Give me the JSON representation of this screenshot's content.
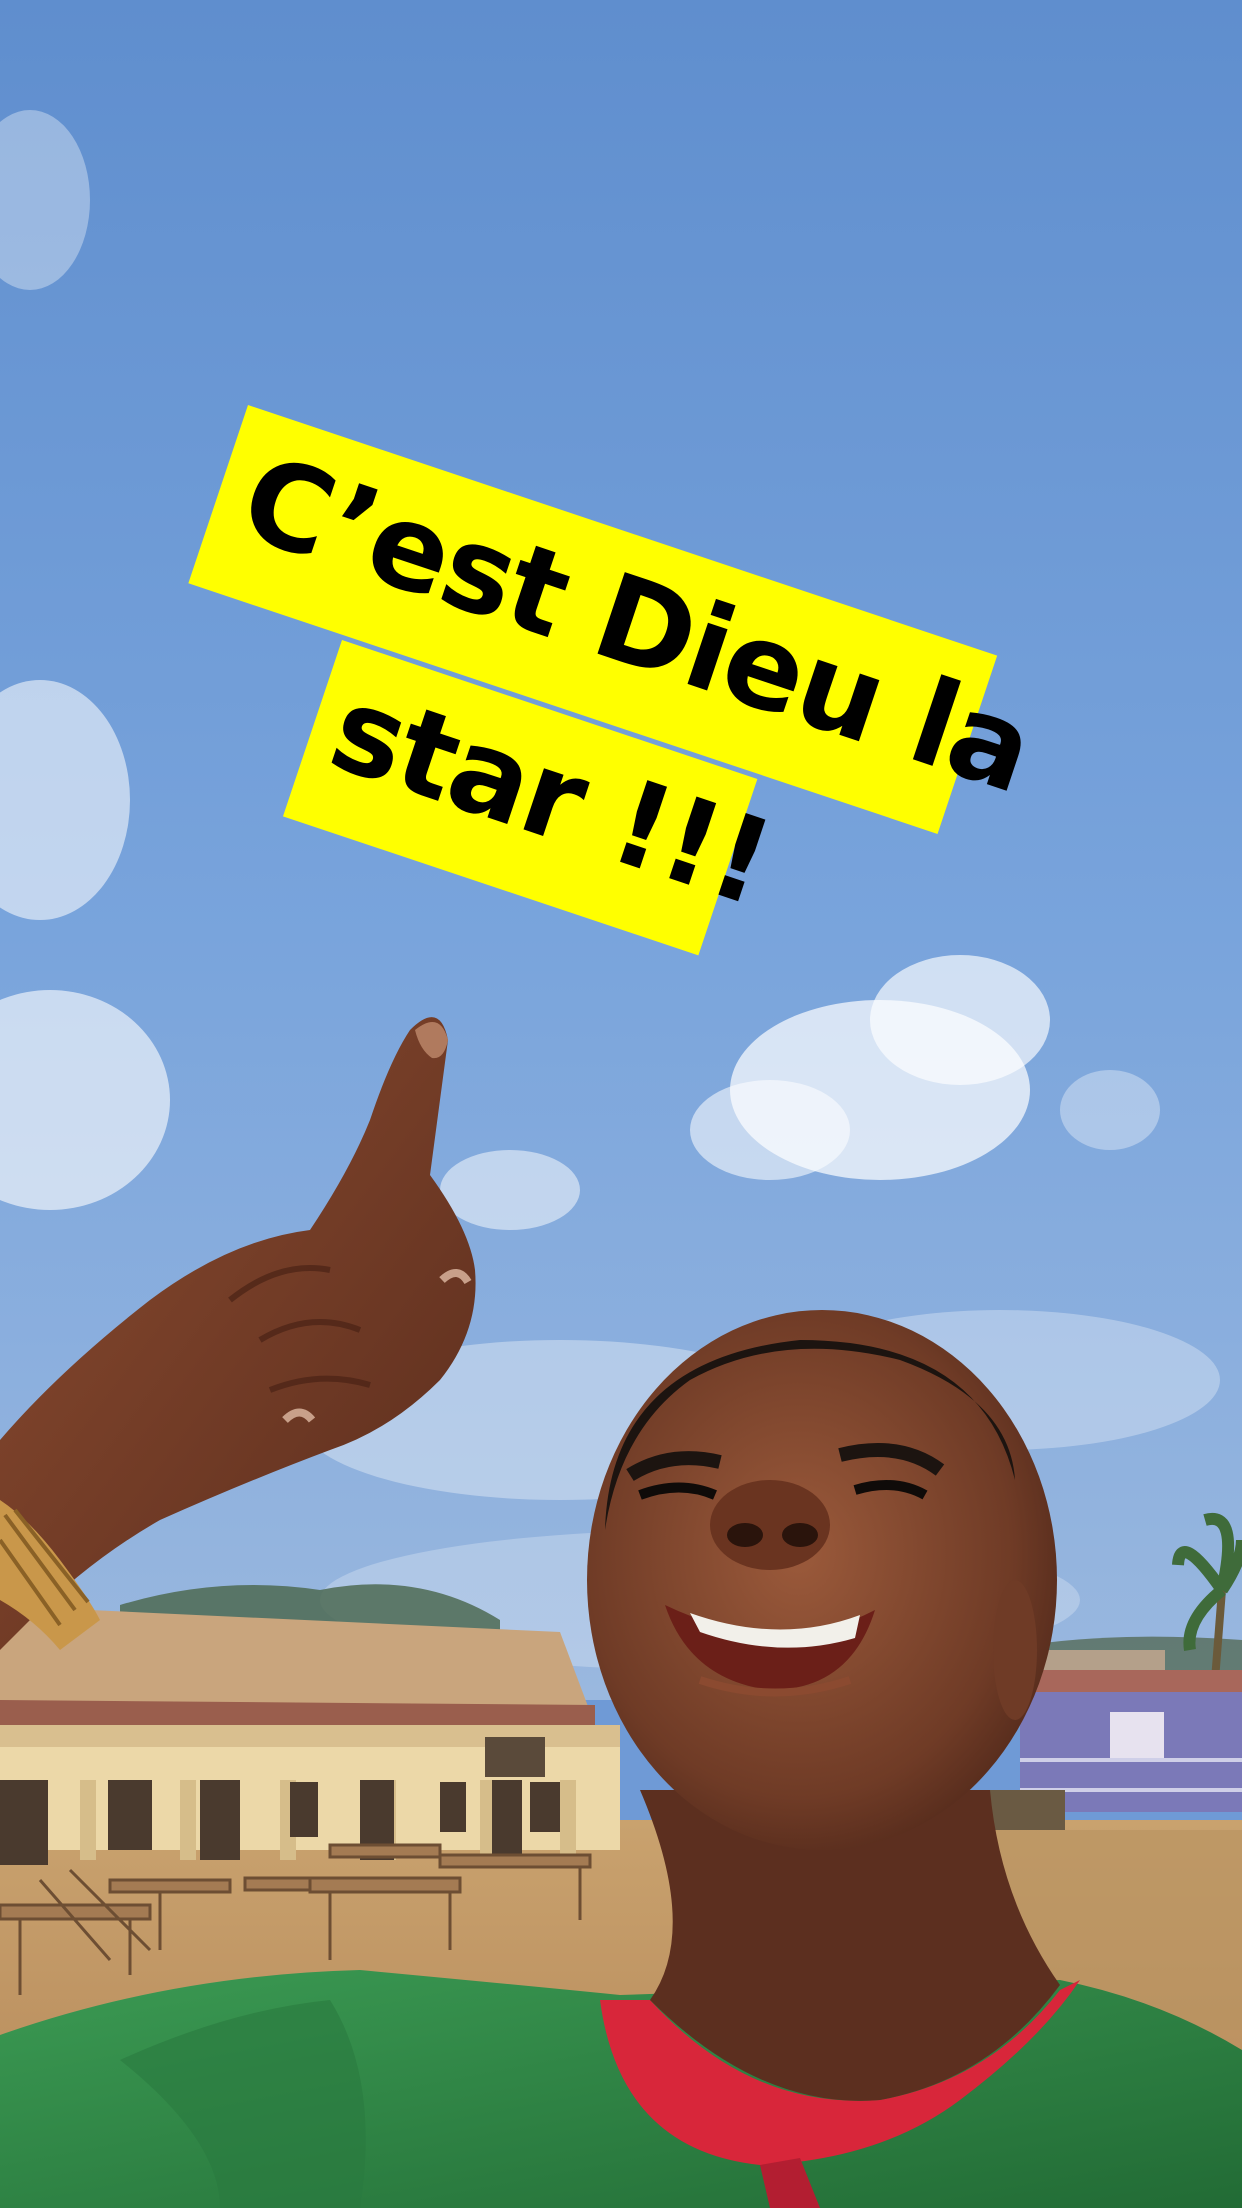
{
  "caption": {
    "line1": "C’est Dieu la",
    "line2": "star !!!"
  },
  "colors": {
    "caption_background": "#ffff00",
    "caption_text": "#000000",
    "sky": "#6f9ad6",
    "shirt": "#2f8443",
    "collar": "#d8263a"
  }
}
